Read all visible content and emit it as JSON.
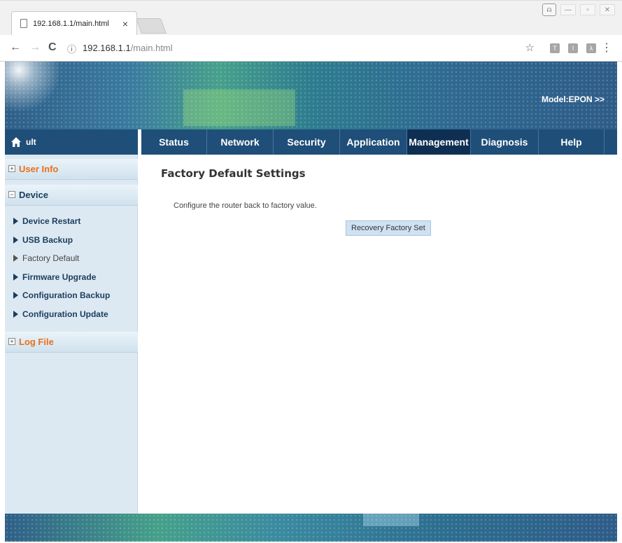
{
  "browser": {
    "tab_title": "192.168.1.1/main.html",
    "tab_close": "×",
    "url_host": "192.168.1.1",
    "url_path": "/main.html",
    "info_icon": "ⓘ",
    "back": "←",
    "forward": "→",
    "reload": "C",
    "star": "☆",
    "menu": "⋮",
    "extensions": [
      "T",
      "I",
      "λ"
    ]
  },
  "banner": {
    "model": "Model:EPON  >>"
  },
  "topnav": {
    "home_label": "ult",
    "items": [
      {
        "label": "Status"
      },
      {
        "label": "Network"
      },
      {
        "label": "Security"
      },
      {
        "label": "Application"
      },
      {
        "label": "Management"
      },
      {
        "label": "Diagnosis"
      },
      {
        "label": "Help"
      }
    ],
    "active": "Management"
  },
  "sidebar": {
    "user_info": "User Info",
    "device": "Device",
    "log_file": "Log File",
    "items": [
      {
        "label": "Device Restart"
      },
      {
        "label": "USB Backup"
      },
      {
        "label": "Factory Default"
      },
      {
        "label": "Firmware Upgrade"
      },
      {
        "label": "Configuration Backup"
      },
      {
        "label": "Configuration Update"
      }
    ],
    "current": "Factory Default"
  },
  "main": {
    "title": "Factory Default Settings",
    "description": "Configure the router back to factory value.",
    "recover_button": "Recovery Factory Set"
  },
  "colors": {
    "nav_bg": "#1f4e79",
    "nav_active": "#0e2f52",
    "sidebar_bg": "#dde9f2",
    "accent_orange": "#e8701a",
    "button_bg": "#cfe2f3"
  }
}
